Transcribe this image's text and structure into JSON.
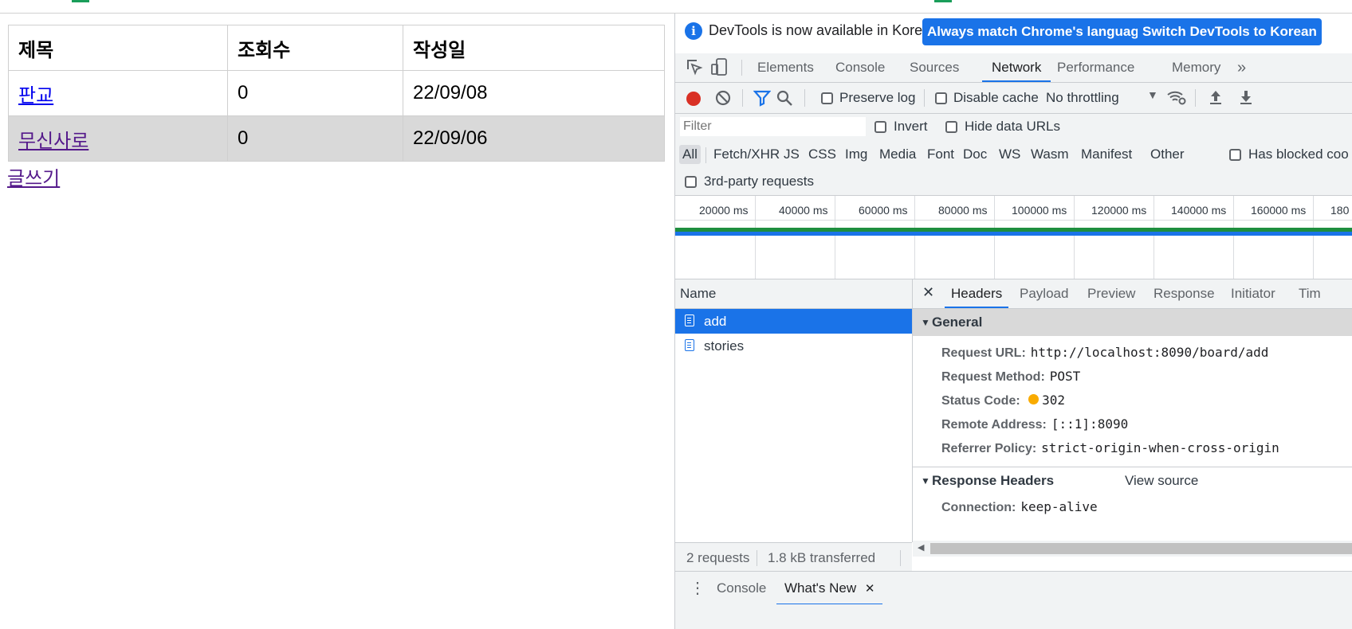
{
  "board": {
    "headers": [
      "제목",
      "조회수",
      "작성일"
    ],
    "rows": [
      {
        "title": "판교",
        "views": "0",
        "date": "22/09/08"
      },
      {
        "title": "무신사로",
        "views": "0",
        "date": "22/09/06"
      }
    ],
    "write_link": "글쓰기"
  },
  "devtools": {
    "infobar": {
      "message": "DevTools is now available in Korean!",
      "btn_match": "Always match Chrome's language",
      "btn_switch": "Switch DevTools to Korean"
    },
    "tabs": [
      "Elements",
      "Console",
      "Sources",
      "Network",
      "Performance",
      "Memory"
    ],
    "more_tabs": "»",
    "toolbar": {
      "preserve_log": "Preserve log",
      "disable_cache": "Disable cache",
      "throttling": "No throttling"
    },
    "filter": {
      "placeholder": "Filter",
      "invert": "Invert",
      "hide_data_urls": "Hide data URLs"
    },
    "types": [
      "All",
      "Fetch/XHR",
      "JS",
      "CSS",
      "Img",
      "Media",
      "Font",
      "Doc",
      "WS",
      "Wasm",
      "Manifest",
      "Other"
    ],
    "has_blocked": "Has blocked coo",
    "third_party": "3rd-party requests",
    "timeline_ticks": [
      "20000 ms",
      "40000 ms",
      "60000 ms",
      "80000 ms",
      "100000 ms",
      "120000 ms",
      "140000 ms",
      "160000 ms",
      "180"
    ],
    "name_header": "Name",
    "requests": [
      "add",
      "stories"
    ],
    "summary": {
      "requests": "2 requests",
      "transferred": "1.8 kB transferred"
    },
    "detail_tabs": [
      "Headers",
      "Payload",
      "Preview",
      "Response",
      "Initiator",
      "Tim"
    ],
    "general": {
      "title": "General",
      "request_url_k": "Request URL:",
      "request_url_v": "http://localhost:8090/board/add",
      "method_k": "Request Method:",
      "method_v": "POST",
      "status_k": "Status Code:",
      "status_v": "302",
      "remote_k": "Remote Address:",
      "remote_v": "[::1]:8090",
      "referrer_k": "Referrer Policy:",
      "referrer_v": "strict-origin-when-cross-origin"
    },
    "response_headers": {
      "title": "Response Headers",
      "view_source": "View source",
      "connection_k": "Connection:",
      "connection_v": "keep-alive"
    },
    "drawer": {
      "console": "Console",
      "whats_new": "What's New"
    }
  },
  "colors": {
    "accent": "#1a73e8",
    "record": "#d93025",
    "status_dot": "#f9ab00"
  }
}
